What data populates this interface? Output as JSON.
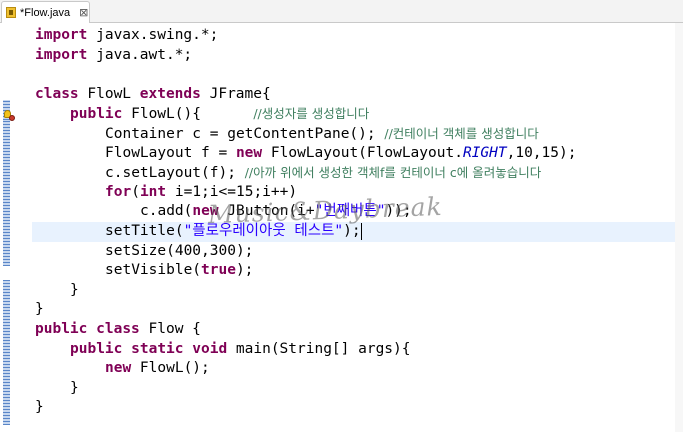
{
  "editor": {
    "tab_title": "*Flow.java",
    "tab_close": "⊠",
    "watermark": "Music&Daybreak"
  },
  "code": {
    "l1_kw": "import",
    "l1_rest": " javax.swing.*;",
    "l2_kw": "import",
    "l2_rest": " java.awt.*;",
    "l4_kw1": "class",
    "l4_name": " FlowL ",
    "l4_kw2": "extends",
    "l4_rest": " JFrame{",
    "l5_kw": "public",
    "l5_code": " FlowL(){      ",
    "l5_comment": "//생성자를 생성합니다",
    "l6_code": "Container c = getContentPane(); ",
    "l6_comment": "//컨테이너 객체를 생성합니다",
    "l7_a": "FlowLayout f = ",
    "l7_kw": "new",
    "l7_b": " FlowLayout(FlowLayout.",
    "l7_const": "RIGHT",
    "l7_c": ",10,15);",
    "l8_code": "c.setLayout(f); ",
    "l8_comment": "//아까 위에서 생성한 객체f를 컨테이너 c에 올려놓습니다",
    "l9_kw1": "for",
    "l9_a": "(",
    "l9_kw2": "int",
    "l9_b": " i=1;i<=15;i++)",
    "l10_a": "c.add(",
    "l10_kw": "new",
    "l10_b": " JButton(i+",
    "l10_str": "\"번째버튼\"",
    "l10_c": "));",
    "l11_a": "setTitle(",
    "l11_str": "\"플로우레이아웃 테스트\"",
    "l11_b": ");",
    "l12_code": "setSize(400,300);",
    "l13_a": "setVisible(",
    "l13_kw": "true",
    "l13_b": ");",
    "brace_close": "}",
    "l17_kw1": "public",
    "l17_kw2": "class",
    "l17_rest": " Flow {",
    "l18_kw1": "public",
    "l18_kw2": "static",
    "l18_kw3": "void",
    "l18_rest": " main(String[] args){",
    "l19_kw": "new",
    "l19_rest": " FlowL();"
  }
}
